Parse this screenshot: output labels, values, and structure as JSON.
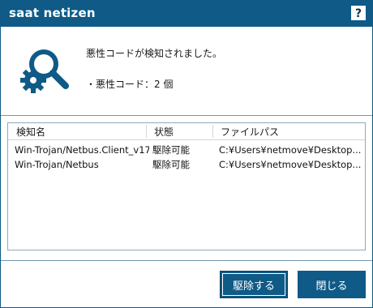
{
  "window": {
    "title": "saat netizen",
    "help_label": "?"
  },
  "summary": {
    "icon": "search-gear-icon",
    "message": "悪性コードが検知されました。",
    "count_text": "・悪性コード：2 個"
  },
  "table": {
    "headers": [
      "検知名",
      "状態",
      "ファイルパス"
    ],
    "rows": [
      [
        "Win-Trojan/Netbus.Client_v17",
        "駆除可能",
        "C:¥Users¥netmove¥Desktop..."
      ],
      [
        "Win-Trojan/Netbus",
        "駆除可能",
        "C:¥Users¥netmove¥Desktop..."
      ]
    ]
  },
  "buttons": {
    "remove_label": "駆除する",
    "close_label": "閉じる"
  },
  "colors": {
    "brand": "#0f5a86",
    "border": "#6f98b4"
  }
}
